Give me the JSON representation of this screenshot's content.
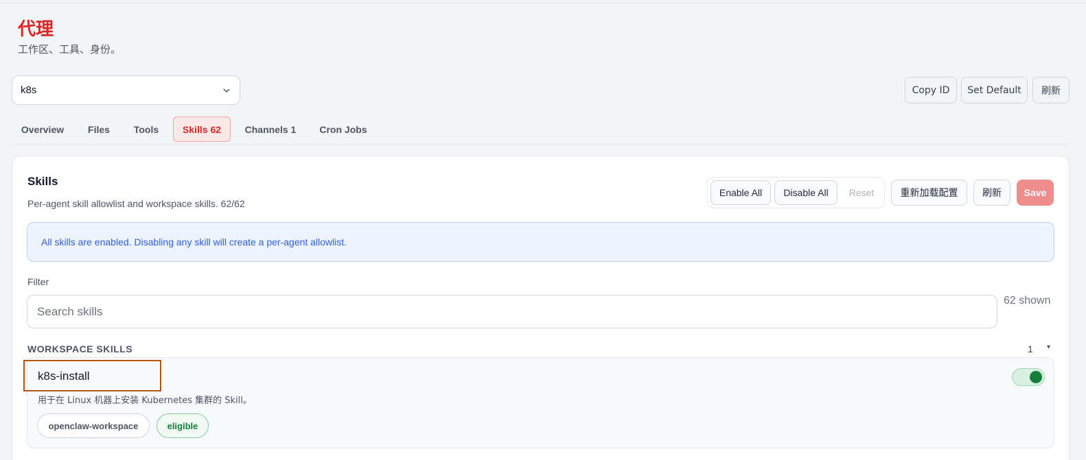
{
  "header": {
    "title": "代理",
    "subtitle": "工作区、工具、身份。"
  },
  "agent_select": {
    "value": "k8s"
  },
  "top_buttons": {
    "copy_id": "Copy ID",
    "set_default": "Set Default",
    "refresh": "刷新"
  },
  "tabs": [
    {
      "label": "Overview"
    },
    {
      "label": "Files"
    },
    {
      "label": "Tools"
    },
    {
      "label": "Skills 62",
      "active": true
    },
    {
      "label": "Channels 1"
    },
    {
      "label": "Cron Jobs"
    }
  ],
  "skills_panel": {
    "title": "Skills",
    "subtitle": "Per-agent skill allowlist and workspace skills. 62/62",
    "enable_all": "Enable All",
    "disable_all": "Disable All",
    "reset": "Reset",
    "reload_config": "重新加载配置",
    "refresh": "刷新",
    "save": "Save",
    "info": "All skills are enabled. Disabling any skill will create a per-agent allowlist.",
    "filter_label": "Filter",
    "search_placeholder": "Search skills",
    "shown_count": "62 shown",
    "section": {
      "label": "WORKSPACE SKILLS",
      "count": "1",
      "caret": "▾"
    },
    "skills": [
      {
        "name": "k8s-install",
        "description": "用于在 Linux 机器上安装 Kubernetes 集群的 Skill。",
        "tags": [
          "openclaw-workspace",
          "eligible"
        ],
        "enabled": true
      }
    ]
  },
  "colors": {
    "accent": "#dc2626",
    "info": "#2d5fd6",
    "toggle_on": "#15803d"
  }
}
